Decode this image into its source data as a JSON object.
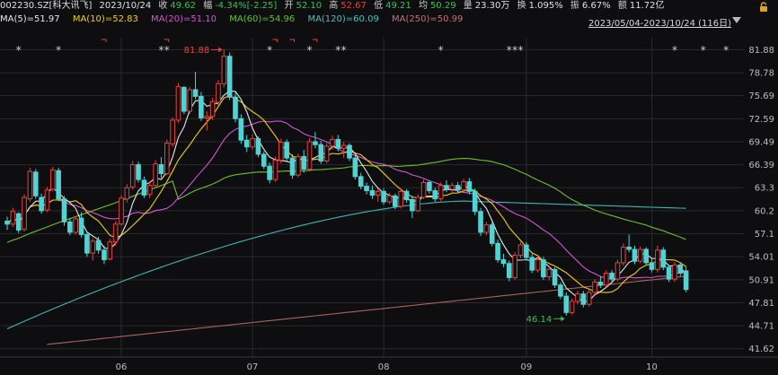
{
  "header": {
    "code": "002230.SZ[科大讯飞]",
    "date": "2023/10/24",
    "close_label": "收",
    "close": "49.62",
    "chg_label": "幅",
    "chg": "-4.34%[-2.25]",
    "open_label": "开",
    "open": "52.10",
    "high_label": "高",
    "high": "52.67",
    "low_label": "低",
    "low": "49.21",
    "avg_label": "均",
    "avg": "50.29",
    "vol_label": "量",
    "vol": "23.30万",
    "turn_label": "换",
    "turn": "1.095%",
    "amp_label": "振",
    "amp": "6.67%",
    "amt_label": "额",
    "amt": "11.72亿"
  },
  "ma": [
    {
      "label": "MA(5)=51.97",
      "color": "#e8e8e8"
    },
    {
      "label": "MA(10)=52.83",
      "color": "#f2d000"
    },
    {
      "label": "MA(20)=51.10",
      "color": "#d455d4"
    },
    {
      "label": "MA(60)=54.96",
      "color": "#6bbf2a"
    },
    {
      "label": "MA(120)=60.09",
      "color": "#4cc0c0"
    },
    {
      "label": "MA(250)=50.99",
      "color": "#c87070"
    }
  ],
  "range_text": "2023/05/04-2023/10/24 (116日)",
  "colors": {
    "up": "#e8413c",
    "down": "#4ed4d4",
    "bg": "#0e0e10",
    "grid": "#2a2a2e",
    "ma5": "#e8e8e8",
    "ma10": "#f2d000",
    "ma20": "#d455d4",
    "ma60": "#6bbf2a",
    "ma120": "#3fb5b5",
    "ma250": "#a86262",
    "marker": "#cccccc",
    "flag": "#e8413c"
  },
  "chart_data": {
    "type": "candlestick",
    "ylim": [
      40.5,
      83.5
    ],
    "y_ticks": [
      "81.88",
      "78.78",
      "75.69",
      "72.59",
      "69.49",
      "66.39",
      "63.3",
      "60.2",
      "57.1",
      "54.01",
      "50.91",
      "47.81",
      "44.71",
      "41.62"
    ],
    "x_ticks": [
      "06",
      "07",
      "08",
      "09",
      "10"
    ],
    "annotations": [
      {
        "text": "81.88",
        "value": 81.88,
        "index": 38,
        "kind": "high"
      },
      {
        "text": "46.14",
        "value": 46.14,
        "index": 98,
        "kind": "low"
      }
    ],
    "markers": {
      "symbol": "*",
      "indices": [
        2,
        9,
        27,
        28,
        46,
        53,
        58,
        59,
        76,
        88,
        89,
        90,
        117,
        122,
        126
      ]
    },
    "flags": {
      "symbol": "⌐",
      "indices": [
        17,
        28,
        47,
        50,
        54
      ]
    },
    "candles": [
      [
        58.8,
        59.4,
        57.6,
        58.4
      ],
      [
        58.4,
        60.6,
        58.0,
        60.1
      ],
      [
        59.8,
        60.0,
        57.2,
        57.6
      ],
      [
        57.7,
        62.4,
        57.4,
        62.0
      ],
      [
        61.8,
        66.0,
        61.4,
        65.5
      ],
      [
        65.4,
        65.8,
        61.8,
        62.2
      ],
      [
        62.0,
        62.5,
        59.8,
        60.2
      ],
      [
        60.3,
        63.4,
        60.0,
        63.0
      ],
      [
        63.1,
        66.1,
        62.8,
        65.7
      ],
      [
        65.6,
        66.0,
        61.5,
        61.8
      ],
      [
        61.8,
        62.2,
        58.2,
        58.7
      ],
      [
        58.7,
        59.2,
        56.9,
        57.3
      ],
      [
        57.3,
        59.5,
        57.0,
        59.1
      ],
      [
        59.2,
        60.0,
        56.6,
        57.0
      ],
      [
        57.0,
        57.4,
        54.0,
        54.5
      ],
      [
        54.5,
        56.5,
        53.5,
        56.1
      ],
      [
        56.2,
        56.7,
        54.4,
        54.9
      ],
      [
        54.9,
        55.5,
        53.0,
        53.6
      ],
      [
        53.7,
        56.4,
        53.5,
        56.0
      ],
      [
        56.0,
        58.8,
        55.5,
        58.4
      ],
      [
        58.4,
        62.3,
        58.2,
        61.9
      ],
      [
        61.8,
        63.8,
        61.3,
        63.3
      ],
      [
        63.4,
        66.9,
        63.0,
        66.4
      ],
      [
        66.4,
        66.8,
        64.0,
        64.4
      ],
      [
        64.3,
        64.8,
        61.9,
        62.3
      ],
      [
        62.4,
        64.2,
        61.9,
        63.6
      ],
      [
        63.6,
        67.0,
        63.2,
        66.5
      ],
      [
        66.4,
        67.4,
        64.6,
        65.2
      ],
      [
        65.2,
        69.8,
        65.0,
        69.3
      ],
      [
        69.2,
        72.8,
        68.8,
        72.4
      ],
      [
        72.4,
        77.4,
        72.0,
        76.9
      ],
      [
        76.8,
        77.0,
        73.2,
        73.6
      ],
      [
        73.6,
        76.9,
        73.2,
        76.5
      ],
      [
        76.5,
        78.9,
        75.2,
        75.6
      ],
      [
        75.6,
        76.2,
        72.3,
        72.7
      ],
      [
        72.7,
        73.6,
        71.0,
        72.9
      ],
      [
        72.9,
        75.4,
        72.4,
        74.9
      ],
      [
        74.8,
        77.8,
        74.4,
        77.3
      ],
      [
        77.3,
        81.9,
        76.8,
        81.0
      ],
      [
        81.0,
        81.5,
        75.1,
        75.5
      ],
      [
        75.5,
        76.1,
        72.1,
        72.6
      ],
      [
        72.6,
        73.2,
        69.2,
        69.7
      ],
      [
        69.7,
        70.4,
        68.1,
        68.8
      ],
      [
        68.8,
        70.5,
        68.4,
        69.9
      ],
      [
        69.9,
        70.2,
        67.4,
        67.8
      ],
      [
        67.8,
        68.2,
        65.8,
        66.2
      ],
      [
        66.2,
        66.7,
        63.9,
        64.4
      ],
      [
        64.4,
        67.5,
        64.1,
        67.0
      ],
      [
        67.0,
        69.9,
        66.6,
        69.4
      ],
      [
        69.4,
        69.8,
        66.9,
        67.3
      ],
      [
        67.3,
        67.8,
        64.5,
        65.0
      ],
      [
        65.0,
        67.9,
        64.7,
        67.5
      ],
      [
        67.5,
        68.4,
        65.3,
        65.8
      ],
      [
        65.8,
        70.0,
        65.5,
        69.5
      ],
      [
        69.5,
        70.8,
        68.6,
        69.1
      ],
      [
        69.1,
        69.6,
        66.5,
        66.9
      ],
      [
        66.9,
        69.3,
        66.6,
        68.9
      ],
      [
        68.9,
        70.3,
        68.4,
        69.8
      ],
      [
        69.8,
        70.4,
        68.2,
        68.6
      ],
      [
        68.6,
        69.5,
        67.3,
        69.0
      ],
      [
        69.0,
        69.3,
        66.9,
        67.3
      ],
      [
        67.3,
        67.7,
        64.4,
        64.8
      ],
      [
        64.8,
        65.3,
        63.1,
        63.5
      ],
      [
        63.5,
        64.0,
        62.4,
        62.9
      ],
      [
        62.9,
        63.6,
        61.8,
        62.3
      ],
      [
        62.3,
        63.2,
        61.4,
        62.8
      ],
      [
        62.8,
        63.2,
        61.0,
        61.4
      ],
      [
        61.4,
        62.6,
        61.1,
        62.2
      ],
      [
        62.2,
        62.5,
        60.4,
        60.8
      ],
      [
        60.8,
        63.2,
        60.5,
        62.8
      ],
      [
        62.8,
        63.1,
        61.3,
        61.7
      ],
      [
        61.7,
        62.2,
        59.2,
        60.2
      ],
      [
        60.2,
        62.4,
        60.0,
        62.0
      ],
      [
        62.0,
        64.4,
        61.8,
        64.0
      ],
      [
        64.0,
        64.3,
        62.5,
        62.9
      ],
      [
        62.9,
        63.3,
        61.4,
        61.8
      ],
      [
        61.8,
        64.0,
        61.5,
        63.6
      ],
      [
        63.6,
        64.3,
        62.7,
        63.1
      ],
      [
        63.1,
        64.0,
        62.5,
        63.6
      ],
      [
        63.6,
        64.1,
        62.6,
        63.0
      ],
      [
        63.0,
        64.5,
        62.8,
        64.1
      ],
      [
        64.1,
        64.6,
        62.4,
        62.8
      ],
      [
        62.8,
        63.2,
        59.6,
        60.1
      ],
      [
        60.1,
        60.6,
        56.8,
        57.3
      ],
      [
        57.3,
        58.7,
        56.9,
        58.3
      ],
      [
        58.3,
        58.7,
        55.4,
        55.8
      ],
      [
        55.8,
        56.3,
        53.2,
        53.6
      ],
      [
        53.6,
        54.4,
        52.6,
        53.1
      ],
      [
        53.1,
        53.5,
        50.7,
        51.2
      ],
      [
        51.2,
        54.6,
        50.9,
        54.2
      ],
      [
        54.2,
        56.0,
        53.8,
        55.6
      ],
      [
        55.6,
        56.0,
        53.5,
        53.9
      ],
      [
        53.9,
        54.4,
        51.8,
        52.2
      ],
      [
        52.2,
        54.0,
        51.9,
        53.6
      ],
      [
        53.6,
        54.0,
        50.9,
        51.3
      ],
      [
        51.3,
        52.7,
        50.8,
        52.3
      ],
      [
        52.3,
        52.6,
        49.8,
        50.2
      ],
      [
        50.2,
        50.6,
        48.3,
        48.7
      ],
      [
        48.7,
        49.2,
        46.1,
        46.5
      ],
      [
        46.5,
        48.4,
        46.2,
        48.0
      ],
      [
        48.0,
        49.4,
        47.6,
        49.0
      ],
      [
        49.0,
        49.4,
        47.2,
        47.6
      ],
      [
        47.6,
        49.6,
        47.3,
        49.2
      ],
      [
        49.2,
        51.0,
        48.9,
        50.6
      ],
      [
        50.6,
        51.4,
        49.8,
        50.2
      ],
      [
        50.2,
        52.2,
        49.9,
        51.8
      ],
      [
        51.8,
        52.2,
        50.6,
        51.0
      ],
      [
        51.0,
        53.6,
        50.7,
        53.2
      ],
      [
        53.2,
        55.8,
        52.8,
        55.3
      ],
      [
        55.3,
        57.0,
        54.6,
        55.0
      ],
      [
        55.0,
        55.5,
        53.0,
        53.4
      ],
      [
        53.4,
        55.4,
        53.1,
        55.0
      ],
      [
        55.0,
        55.3,
        52.8,
        53.2
      ],
      [
        53.2,
        53.7,
        51.9,
        52.3
      ],
      [
        52.3,
        55.5,
        51.9,
        54.9
      ],
      [
        54.9,
        55.3,
        52.2,
        52.6
      ],
      [
        52.6,
        52.9,
        50.6,
        51.0
      ],
      [
        51.0,
        53.3,
        50.6,
        52.9
      ],
      [
        52.9,
        53.3,
        51.4,
        51.8
      ],
      [
        52.1,
        52.7,
        49.2,
        49.6
      ]
    ]
  }
}
